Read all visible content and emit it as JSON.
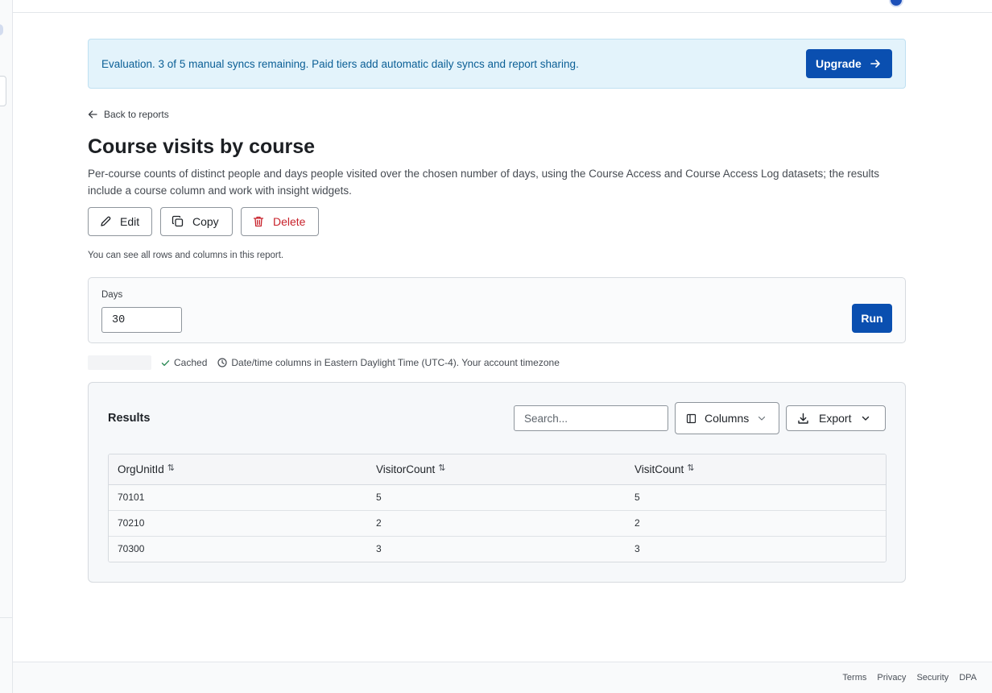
{
  "banner": {
    "text": "Evaluation. 3 of 5 manual syncs remaining. Paid tiers add automatic daily syncs and report sharing.",
    "upgrade_label": "Upgrade"
  },
  "nav": {
    "back_label": "Back to reports"
  },
  "report": {
    "title": "Course visits by course",
    "description": "Per-course counts of distinct people and days people visited over the chosen number of days, using the Course Access and Course Access Log datasets; the results include a course column and work with insight widgets.",
    "permissions_note": "You can see all rows and columns in this report."
  },
  "actions": {
    "edit": "Edit",
    "copy": "Copy",
    "delete": "Delete"
  },
  "params": {
    "days_label": "Days",
    "days_value": "30",
    "run_label": "Run"
  },
  "status": {
    "cached": "Cached",
    "timezone": "Date/time columns in Eastern Daylight Time (UTC-4). Your account timezone"
  },
  "results": {
    "title": "Results",
    "search_placeholder": "Search...",
    "columns_label": "Columns",
    "export_label": "Export",
    "headers": [
      "OrgUnitId",
      "VisitorCount",
      "VisitCount"
    ],
    "rows": [
      [
        "70101",
        "5",
        "5"
      ],
      [
        "70210",
        "2",
        "2"
      ],
      [
        "70300",
        "3",
        "3"
      ]
    ]
  },
  "footer": {
    "links": [
      "Terms",
      "Privacy",
      "Security",
      "DPA"
    ]
  },
  "colors": {
    "primary": "#0a4fb0",
    "danger": "#c8222b",
    "banner_bg": "#e3f3fb",
    "banner_text": "#0b5f96",
    "success": "#2e8b57"
  }
}
